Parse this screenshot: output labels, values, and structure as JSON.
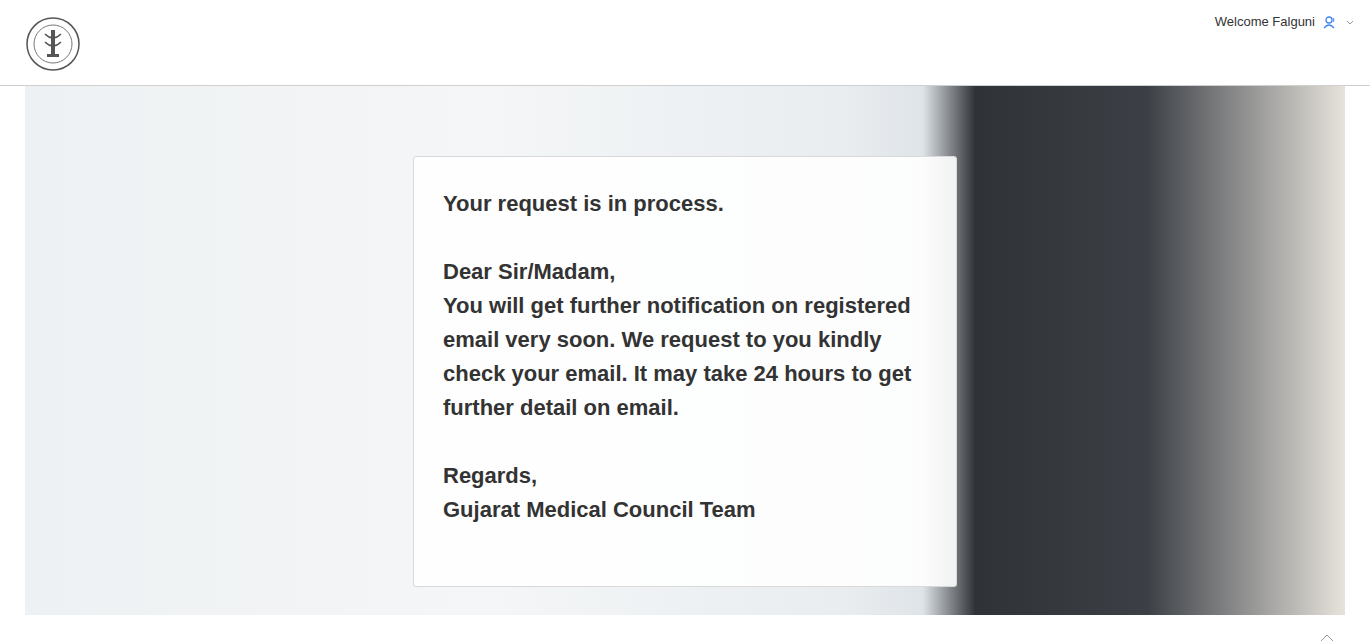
{
  "header": {
    "welcome": "Welcome Falguni"
  },
  "message": {
    "title": "Your request is in process.",
    "greeting": "Dear Sir/Madam,",
    "body": "You will get further notification on registered email very soon. We request to you kindly check your email. It may take 24 hours to get further detail on email.",
    "closing": "Regards,",
    "signature": "Gujarat Medical Council Team"
  }
}
